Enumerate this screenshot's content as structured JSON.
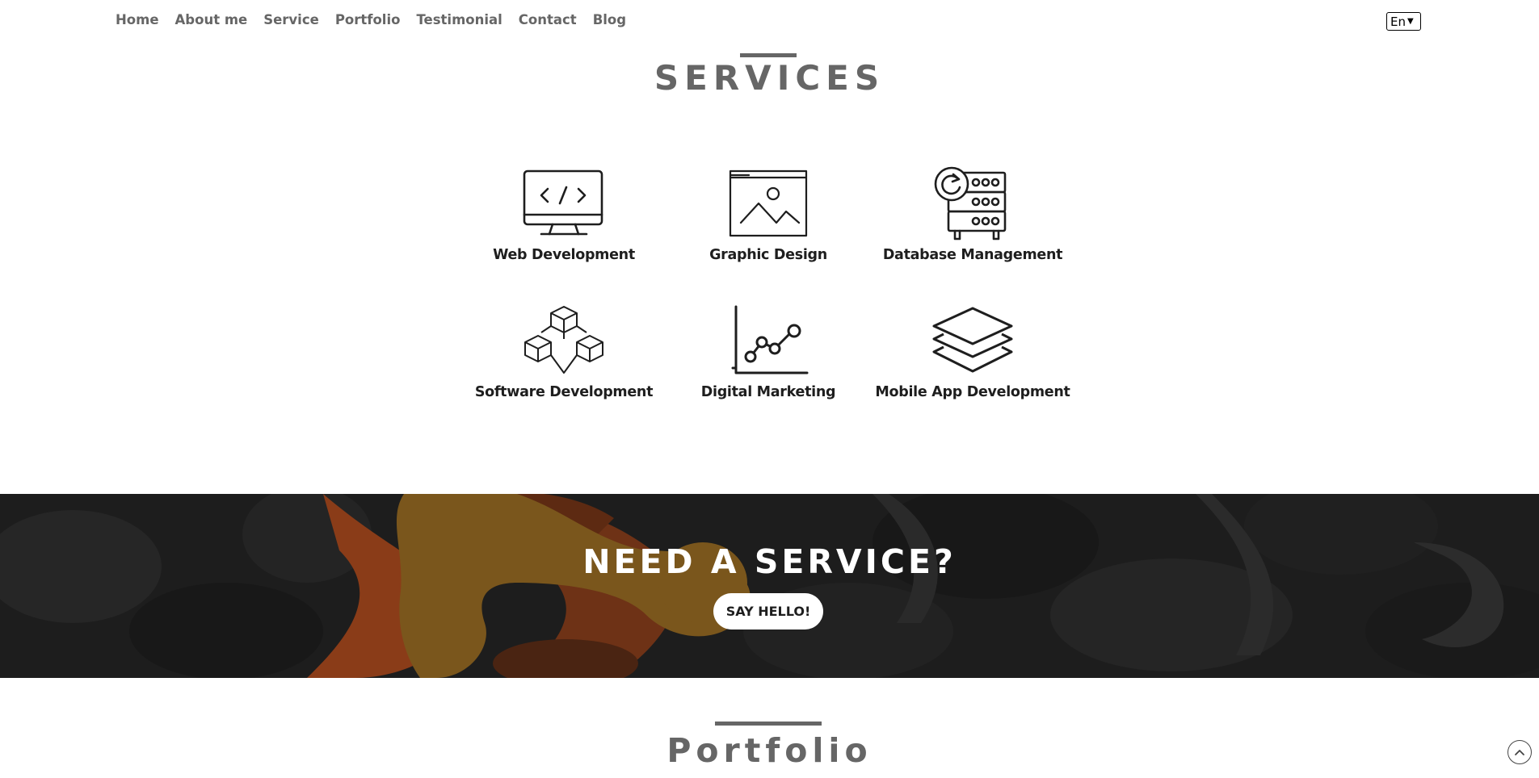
{
  "nav": {
    "links": [
      "Home",
      "About me",
      "Service",
      "Portfolio",
      "Testimonial",
      "Contact",
      "Blog"
    ],
    "language": "En"
  },
  "services": {
    "title": "SERVICES",
    "items": [
      {
        "label": "Web Development",
        "icon": "monitor-code-icon"
      },
      {
        "label": "Graphic Design",
        "icon": "image-window-icon"
      },
      {
        "label": "Database Management",
        "icon": "server-refresh-icon"
      },
      {
        "label": "Software Development",
        "icon": "cubes-icon"
      },
      {
        "label": "Digital Marketing",
        "icon": "line-chart-icon"
      },
      {
        "label": "Mobile App Development",
        "icon": "layers-icon"
      }
    ]
  },
  "banner": {
    "title": "NEED A SERVICE?",
    "button": "SAY HELLO!"
  },
  "portfolio": {
    "title": "Portfolio"
  },
  "colors": {
    "heading": "#666666",
    "text": "#1e1e1e",
    "banner_bg": "#1d1d1d",
    "accent_gold": "#7a561c",
    "accent_orange": "#8a3c18"
  }
}
